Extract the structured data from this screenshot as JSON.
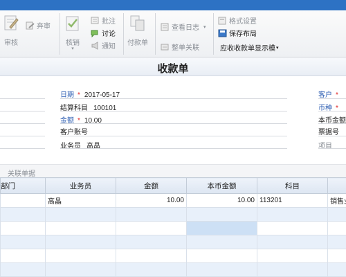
{
  "ribbon": {
    "submit_label": "弃审",
    "audit_label": "审核",
    "approve_label": "批注",
    "discuss_label": "讨论",
    "notify_label": "通知",
    "writeoff_label": "核销",
    "pay_label": "付款单",
    "view_log_label": "查看日志",
    "doc_link_label": "整单关联",
    "format_setting_label": "格式设置",
    "save_layout_label": "保存布局",
    "display_template_label": "应收收款单显示模"
  },
  "form": {
    "title": "收款单",
    "date_label": "日期",
    "date_value": "2017-05-17",
    "account_label": "结算科目",
    "account_value": "100101",
    "amount_label": "金额",
    "amount_value": "10.00",
    "customer_account_label": "客户账号",
    "salesman_label": "业务员",
    "salesman_value": "高晶",
    "customer_label": "客户",
    "currency_label": "币种",
    "local_amount_label": "本币金额",
    "ticket_label": "票据号",
    "project_label": "项目",
    "required_mark": "*"
  },
  "subtab": {
    "label": "关联单据"
  },
  "grid": {
    "columns": [
      "部门",
      "业务员",
      "金额",
      "本币金额",
      "科目",
      "销售业"
    ],
    "rows": [
      [
        "",
        "高晶",
        "10.00",
        "10.00",
        "113201",
        "销售业"
      ]
    ]
  }
}
